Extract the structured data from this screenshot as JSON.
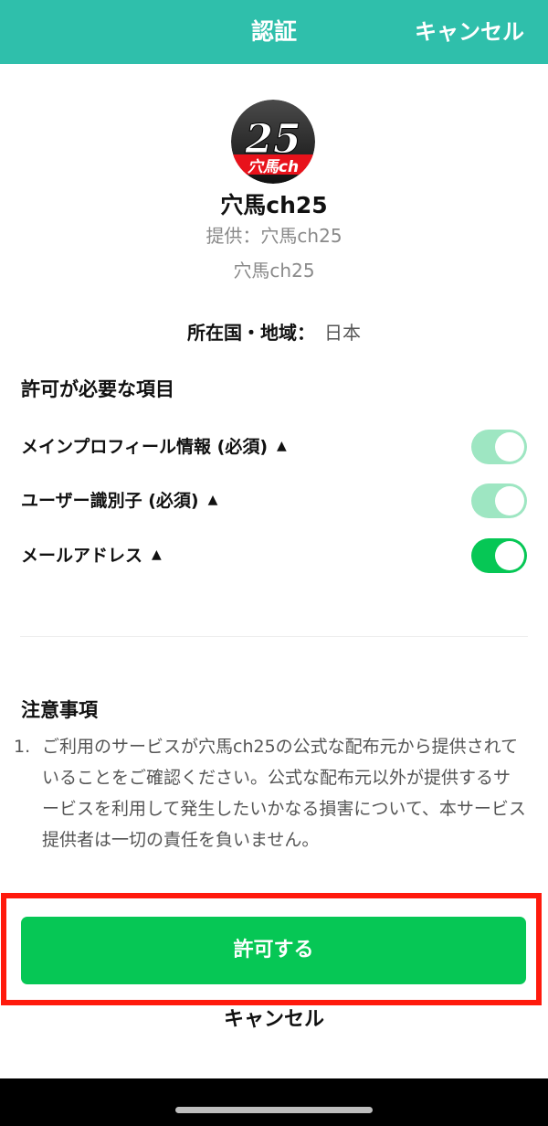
{
  "header": {
    "title": "認証",
    "cancel_label": "キャンセル"
  },
  "app": {
    "logo_number": "25",
    "logo_text": "穴馬ch",
    "name": "穴馬ch25",
    "provider": "提供：穴馬ch25",
    "subtitle": "穴馬ch25"
  },
  "region": {
    "label": "所在国・地域：",
    "value": "日本"
  },
  "permissions": {
    "title": "許可が必要な項目",
    "items": [
      {
        "label": "メインプロフィール情報 (必須)",
        "icon": "chevron-up-icon",
        "enabled": true,
        "locked": true
      },
      {
        "label": "ユーザー識別子 (必須)",
        "icon": "chevron-up-icon",
        "enabled": true,
        "locked": true
      },
      {
        "label": "メールアドレス",
        "icon": "chevron-up-icon",
        "enabled": true,
        "locked": false
      }
    ]
  },
  "notes": {
    "title": "注意事項",
    "items": [
      {
        "number": "1.",
        "text": "ご利用のサービスが穴馬ch25の公式な配布元から提供されていることをご確認ください。公式な配布元以外が提供するサービスを利用して発生したいかなる損害について、本サービス提供者は一切の責任を負いません。"
      }
    ]
  },
  "actions": {
    "allow_label": "許可する",
    "cancel_label": "キャンセル"
  },
  "colors": {
    "header": "#2fbfab",
    "accent": "#06c755",
    "toggle_disabled": "#9ee6c2",
    "highlight": "#ff1a0d"
  }
}
